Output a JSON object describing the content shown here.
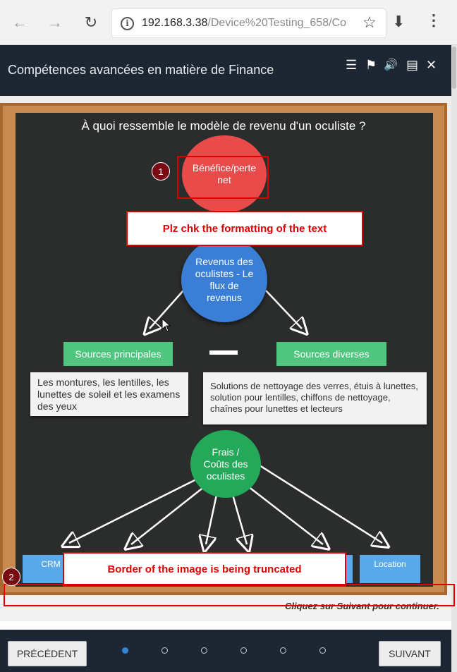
{
  "browser": {
    "url_host": "192.168.3.38",
    "url_path": "/Device%20Testing_658/Co",
    "back_icon": "←",
    "forward_icon": "→",
    "reload_icon": "↻",
    "info_icon": "i",
    "star_icon": "☆",
    "download_icon": "⬇",
    "menu_icon": "⋮"
  },
  "header": {
    "title": "Compétences avancées en matière de Finance",
    "icons": {
      "menu": "☰",
      "bookmark": "⚑",
      "audio": "🔊",
      "notes": "▤",
      "close": "✕"
    }
  },
  "slide": {
    "title": "À quoi ressemble le modèle de revenu d'un oculiste ?",
    "net_profit": "Bénéfice/perte net",
    "revenue": "Revenus des oculistes - Le flux de revenus",
    "main_sources": "Sources principales",
    "other_sources": "Sources diverses",
    "main_desc": "Les montures, les lentilles, les lunettes de soleil et les examens des yeux",
    "other_desc": "Solutions de nettoyage des verres, étuis à lunettes, solution pour lentilles, chiffons de nettoyage, chaînes pour lunettes et lecteurs",
    "costs": "Frais / Coûts des oculistes",
    "crm": "CRM",
    "location": "Location",
    "continue_text": "Cliquez sur Suivant pour continuer."
  },
  "annotations": [
    {
      "num": "1",
      "text": "Plz chk the formatting of the text"
    },
    {
      "num": "2",
      "text": "Border of the image is being truncated"
    }
  ],
  "footer": {
    "prev": "PRÉCÉDENT",
    "next": "SUIVANT",
    "dots": 6,
    "active_dot": 0
  },
  "colors": {
    "header_bg": "#1d2733",
    "red_circle": "#e94b4b",
    "blue_circle": "#3a7fd5",
    "green_circle": "#24a85a",
    "green_box": "#4fc57e",
    "annotation": "#dd0000"
  }
}
